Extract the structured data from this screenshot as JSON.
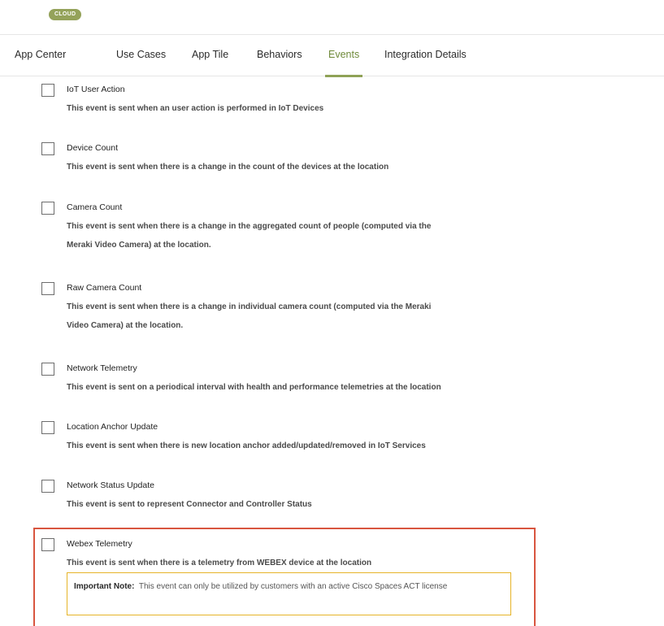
{
  "badge": "CLOUD",
  "tabs": [
    {
      "label": "App Center"
    },
    {
      "label": "Use Cases"
    },
    {
      "label": "App Tile"
    },
    {
      "label": "Behaviors"
    },
    {
      "label": "Events"
    },
    {
      "label": "Integration Details"
    }
  ],
  "active_tab": "Events",
  "events": [
    {
      "title": "IoT User Action",
      "description": "This event is sent when an user action is performed in IoT Devices",
      "checked": false
    },
    {
      "title": "Device Count",
      "description": "This event is sent when there is a change in the count of the devices at the location",
      "checked": false
    },
    {
      "title": "Camera Count",
      "description": "This event is sent when there is a change in the aggregated count of people (computed via the",
      "description2": "Meraki Video Camera) at the location.",
      "checked": false
    },
    {
      "title": "Raw Camera Count",
      "description": "This event is sent when there is a change in individual camera count (computed via the Meraki",
      "description2": "Video Camera) at the location.",
      "checked": false
    },
    {
      "title": "Network Telemetry",
      "description": "This event is sent on a periodical interval with health and performance telemetries at the location",
      "checked": false
    },
    {
      "title": "Location Anchor Update",
      "description": "This event is sent when there is new location anchor added/updated/removed in IoT Services",
      "checked": false
    },
    {
      "title": "Network Status Update",
      "description": "This event is sent to represent Connector and Controller Status",
      "checked": false
    },
    {
      "title": "Webex Telemetry",
      "description": "This event is sent when there is a telemetry from WEBEX device at the location",
      "checked": false
    }
  ],
  "note": {
    "label": "Important Note:",
    "text": "This event can only be utilized by customers with an active Cisco Spaces ACT license"
  },
  "colors": {
    "accent": "#8fa257",
    "highlight_border": "#d8553f",
    "note_border": "#e6b428"
  }
}
